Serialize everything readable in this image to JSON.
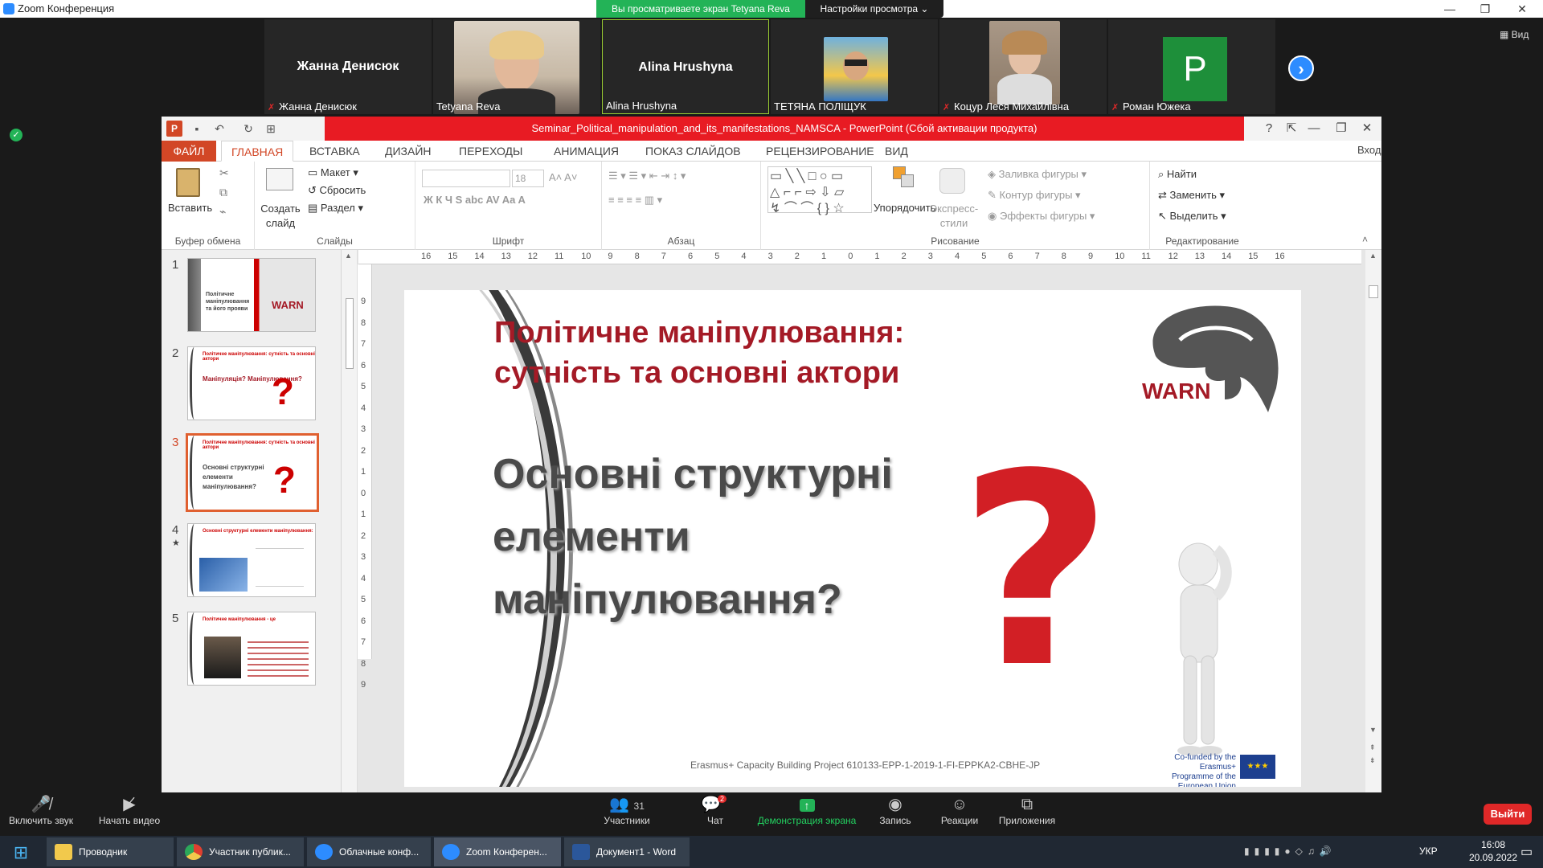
{
  "window": {
    "title": "Zoom Конференция",
    "sharing_banner": "Вы просматриваете экран Tetyana Reva",
    "view_options": "Настройки просмотра ⌄"
  },
  "participants": [
    {
      "big_name": "Жанна Денисюк",
      "label": "Жанна Денисюк",
      "muted": true,
      "video": false
    },
    {
      "big_name": "",
      "label": "Tetyana Reva",
      "muted": false,
      "video": true
    },
    {
      "big_name": "Alina Hrushyna",
      "label": "Alina Hrushyna",
      "muted": false,
      "video": false
    },
    {
      "big_name": "",
      "label": "ТЕТЯНА ПОЛІЩУК",
      "muted": false,
      "video": true
    },
    {
      "big_name": "",
      "label": "Коцур Леся Михайлівна",
      "muted": true,
      "video": true
    },
    {
      "big_name": "",
      "label": "Роман Южека",
      "muted": true,
      "video": false,
      "avatar_letter": "P",
      "avatar_color": "#1e8f3a"
    }
  ],
  "view_button": "Вид",
  "ppt": {
    "title": "Seminar_Political_manipulation_and_its_manifestations_NAMSCA -  PowerPoint (Сбой активации продукта)",
    "signin": "Вход",
    "tabs": [
      "ФАЙЛ",
      "ГЛАВНАЯ",
      "ВСТАВКА",
      "ДИЗАЙН",
      "ПЕРЕХОДЫ",
      "АНИМАЦИЯ",
      "ПОКАЗ СЛАЙДОВ",
      "РЕЦЕНЗИРОВАНИЕ",
      "ВИД"
    ],
    "ribbon": {
      "paste": "Вставить",
      "clipboard": "Буфер обмена",
      "new_slide": "Создать слайд",
      "layout": "Макет",
      "reset": "Сбросить",
      "section": "Раздел",
      "slides": "Слайды",
      "font_size": "18",
      "font_group": "Шрифт",
      "paragraph_group": "Абзац",
      "arrange": "Упорядочить",
      "quick_styles": "Экспресс-стили",
      "shape_fill": "Заливка фигуры",
      "shape_outline": "Контур фигуры",
      "shape_effects": "Эффекты фигуры",
      "drawing": "Рисование",
      "find": "Найти",
      "replace": "Заменить",
      "select": "Выделить",
      "editing": "Редактирование"
    },
    "ruler_h": [
      "16",
      "15",
      "14",
      "13",
      "12",
      "11",
      "10",
      "9",
      "8",
      "7",
      "6",
      "5",
      "4",
      "3",
      "2",
      "1",
      "0",
      "1",
      "2",
      "3",
      "4",
      "5",
      "6",
      "7",
      "8",
      "9",
      "10",
      "11",
      "12",
      "13",
      "14",
      "15",
      "16"
    ],
    "ruler_v": [
      "9",
      "8",
      "7",
      "6",
      "5",
      "4",
      "3",
      "2",
      "1",
      "0",
      "1",
      "2",
      "3",
      "4",
      "5",
      "6",
      "7",
      "8",
      "9"
    ],
    "thumbnails": [
      {
        "num": "1",
        "title": "",
        "text": "Політичне маніпулювання та його прояви"
      },
      {
        "num": "2",
        "title": "Політичне маніпулювання: сутність та основні актори",
        "text": "Маніпуляція? Маніпулювання?"
      },
      {
        "num": "3",
        "title": "Політичне маніпулювання: сутність та основні актори",
        "text": "Основні структурні елементи маніпулювання?",
        "selected": true
      },
      {
        "num": "4",
        "title": "Основні структурні елементи маніпулювання:",
        "text": ""
      },
      {
        "num": "5",
        "title": "Політичне маніпулювання - це",
        "text": ""
      }
    ],
    "slide": {
      "title_line1": "Політичне маніпулювання:",
      "title_line2": "сутність та основні актори",
      "question_line1": "Основні структурні",
      "question_line2": "елементи",
      "question_line3": "маніпулювання?",
      "logo_text": "WARN",
      "footer": "Erasmus+ Capacity Building Project  610133-EPP-1-2019-1-FI-EPPKA2-CBHE-JP",
      "cofund": "Co-funded by the Erasmus+ Programme of the European Union",
      "accent": "#a41a26"
    }
  },
  "controls": {
    "audio": "Включить звук",
    "video": "Начать видео",
    "participants": "Участники",
    "participants_count": "31",
    "chat": "Чат",
    "chat_badge": "2",
    "share": "Демонстрация экрана",
    "record": "Запись",
    "reactions": "Реакции",
    "apps": "Приложения",
    "leave": "Выйти"
  },
  "taskbar": {
    "items": [
      "Проводник",
      "Участник публик...",
      "Облачные конф...",
      "Zoom Конферен...",
      "Документ1 - Word"
    ],
    "lang": "УКР",
    "time": "16:08",
    "date": "20.09.2022"
  }
}
